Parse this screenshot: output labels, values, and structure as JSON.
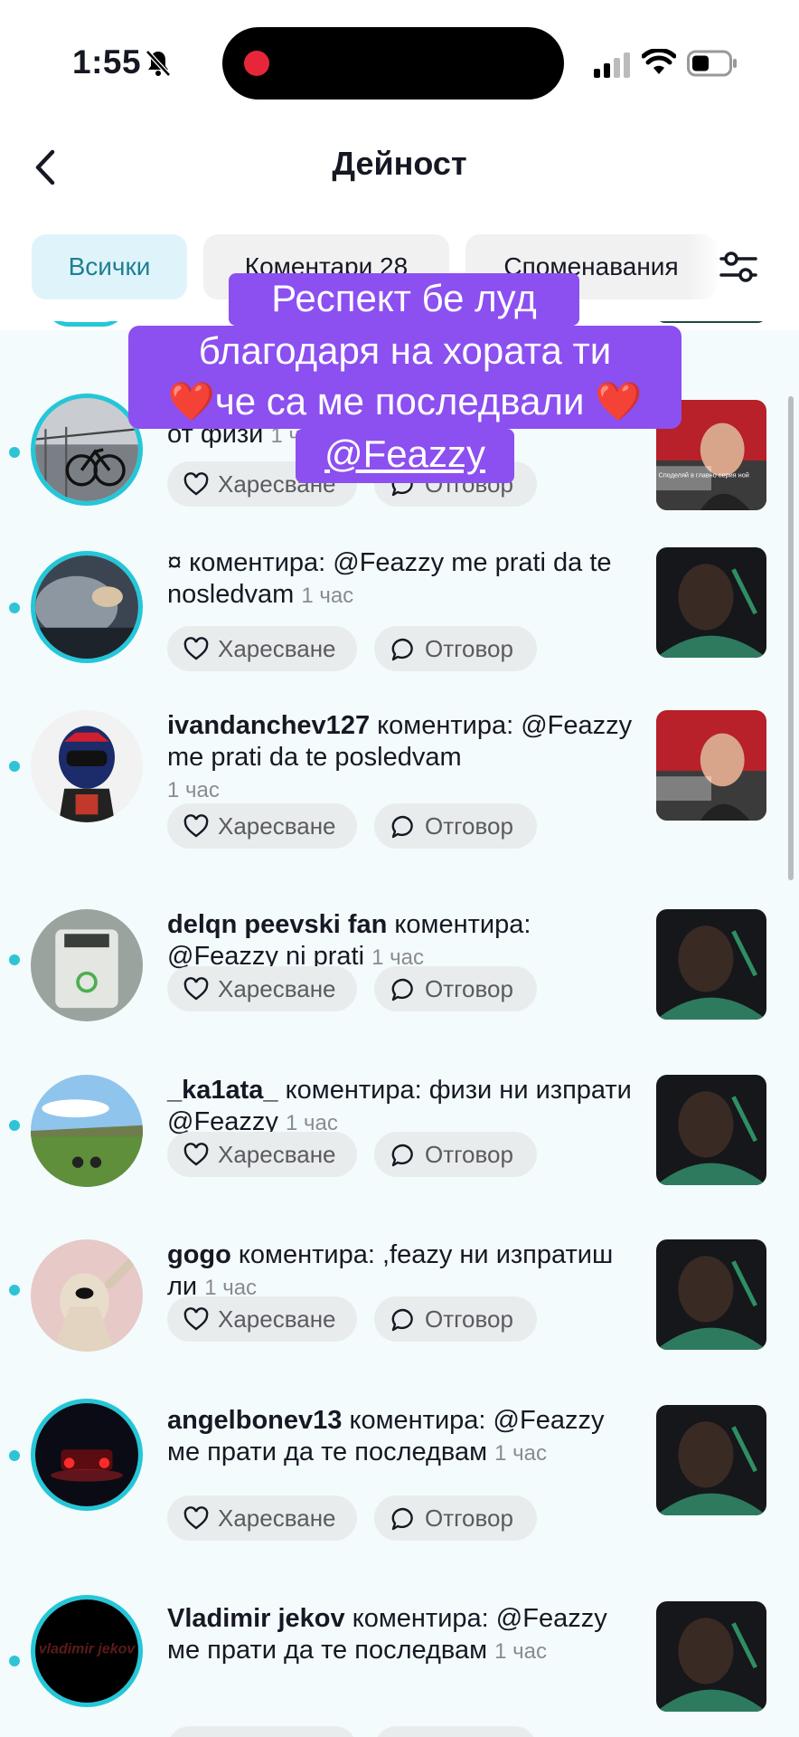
{
  "status_bar": {
    "time": "1:55"
  },
  "header": {
    "title": "Дейност"
  },
  "tabs": [
    {
      "label": "Всички",
      "active": true
    },
    {
      "label": "Коментари 28",
      "active": false
    },
    {
      "label": "Споменавания",
      "active": false
    }
  ],
  "buttons": {
    "like": "Харесване",
    "reply": "Отговор"
  },
  "overlay": {
    "line1": "Респект бе луд",
    "line2": "благодаря на хората ти",
    "line3_text": "че са ме последвали",
    "line4": "@Feazzy"
  },
  "items": [
    {
      "user": "",
      "text": "от физи",
      "time": "1 час"
    },
    {
      "user": "",
      "text": "¤ коментира: @Feazzy me prati da te nosledvam",
      "time": "1 час"
    },
    {
      "user": "ivandanchev127",
      "text": " коментира: @Feazzy me prati da te posledvam",
      "time": "1 час"
    },
    {
      "user": "delqn peevski fan",
      "text": " коментира: @Feazzy ni prati",
      "time": "1 час"
    },
    {
      "user": "_ka1ata_",
      "text": " коментира: физи ни изпрати @Feazzy",
      "time": "1 час"
    },
    {
      "user": "gogo",
      "text": " коментира: ,feazy ни изпратиш ли",
      "time": "1 час"
    },
    {
      "user": "angelbonev13",
      "text": " коментира: @Feazzy ме прати да те последвам",
      "time": "1 час"
    },
    {
      "user": "Vladimir jekov",
      "text": " коментира: @Feazzy ме прати да те последвам",
      "time": "1 час"
    }
  ],
  "thumb_caption": "Споделяй в главно серия ной",
  "avatar_text": "vladimir jekov",
  "colors": {
    "accent": "#23c7d8",
    "overlay": "#8c4ff0",
    "active_tab_bg": "#dff4fa",
    "active_tab_text": "#1f7f93"
  },
  "icons": [
    "back-chevron-icon",
    "filter-sliders-icon",
    "heart-icon",
    "comment-bubble-icon",
    "bell-slash-icon",
    "signal-icon",
    "wifi-icon",
    "battery-icon"
  ]
}
